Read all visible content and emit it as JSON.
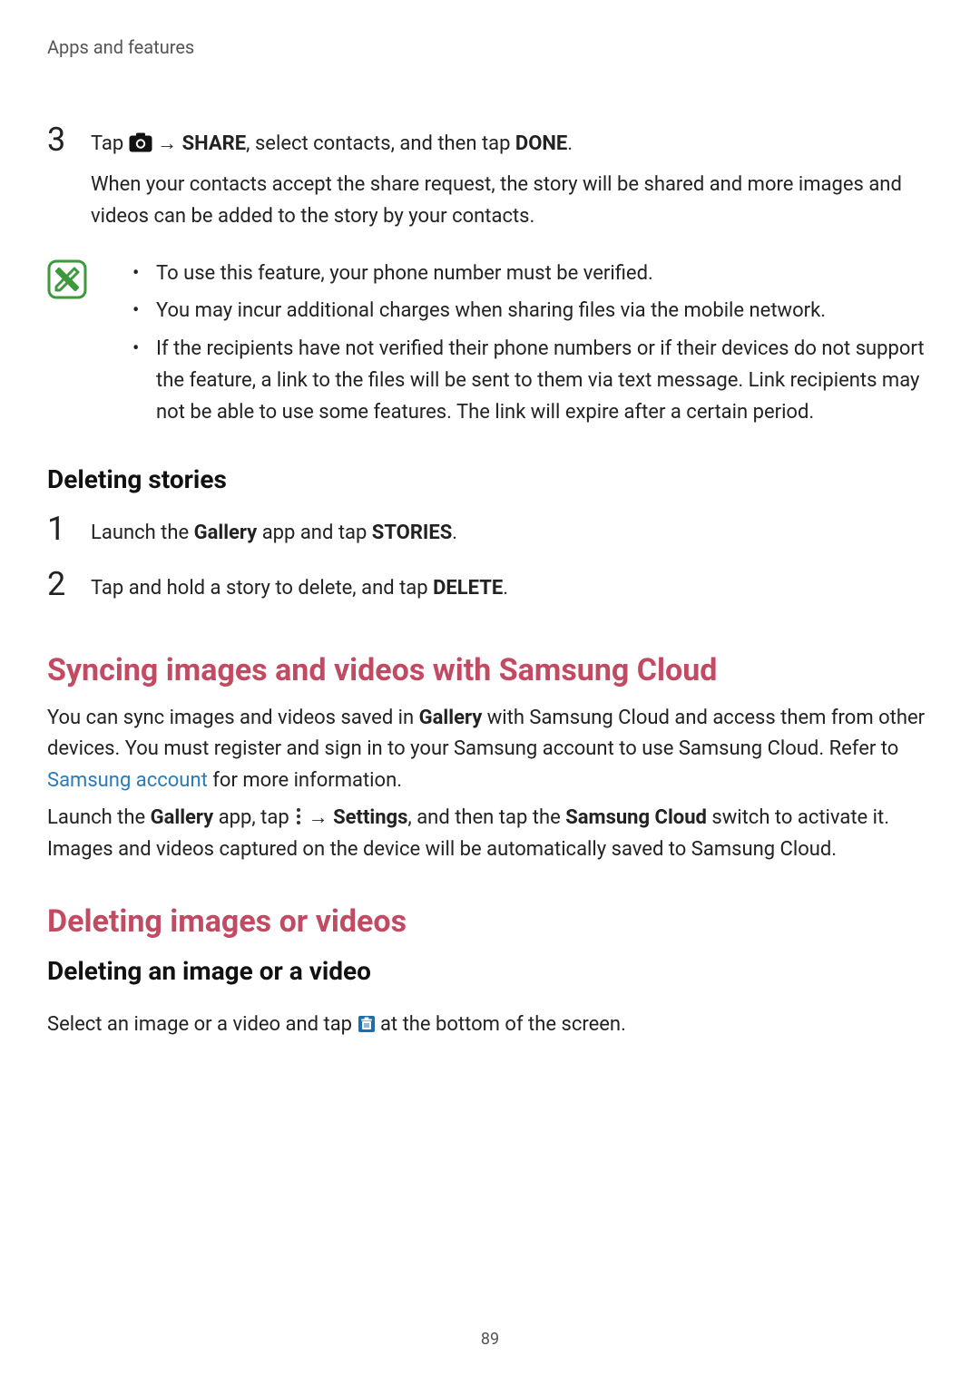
{
  "header": "Apps and features",
  "step3_num": "3",
  "step3_line1_a": "Tap ",
  "step3_line1_b": " → ",
  "step3_share": "SHARE",
  "step3_line1_c": ", select contacts, and then tap ",
  "step3_done": "DONE",
  "step3_line1_d": ".",
  "step3_line2": "When your contacts accept the share request, the story will be shared and more images and videos can be added to the story by your contacts.",
  "note1": "To use this feature, your phone number must be verified.",
  "note2": "You may incur additional charges when sharing files via the mobile network.",
  "note3": "If the recipients have not verified their phone numbers or if their devices do not support the feature, a link to the files will be sent to them via text message. Link recipients may not be able to use some features. The link will expire after a certain period.",
  "del_stories_h": "Deleting stories",
  "del_step1_num": "1",
  "del_step1_a": "Launch the ",
  "del_step1_gallery": "Gallery",
  "del_step1_b": " app and tap ",
  "del_step1_stories": "STORIES",
  "del_step1_c": ".",
  "del_step2_num": "2",
  "del_step2_a": "Tap and hold a story to delete, and tap ",
  "del_step2_delete": "DELETE",
  "del_step2_b": ".",
  "sync_h": "Syncing images and videos with Samsung Cloud",
  "sync_p1_a": "You can sync images and videos saved in ",
  "sync_p1_gallery": "Gallery",
  "sync_p1_b": " with Samsung Cloud and access them from other devices. You must register and sign in to your Samsung account to use Samsung Cloud. Refer to ",
  "sync_p1_link": "Samsung account",
  "sync_p1_c": " for more information.",
  "sync_p2_a": "Launch the ",
  "sync_p2_gallery": "Gallery",
  "sync_p2_b": " app, tap ",
  "sync_p2_c": " → ",
  "sync_p2_settings": "Settings",
  "sync_p2_d": ", and then tap the ",
  "sync_p2_cloud": "Samsung Cloud",
  "sync_p2_e": " switch to activate it. Images and videos captured on the device will be automatically saved to Samsung Cloud.",
  "del_iv_h": "Deleting images or videos",
  "del_iv_sub": "Deleting an image or a video",
  "del_iv_p_a": "Select an image or a video and tap ",
  "del_iv_p_b": " at the bottom of the screen.",
  "page_num": "89"
}
